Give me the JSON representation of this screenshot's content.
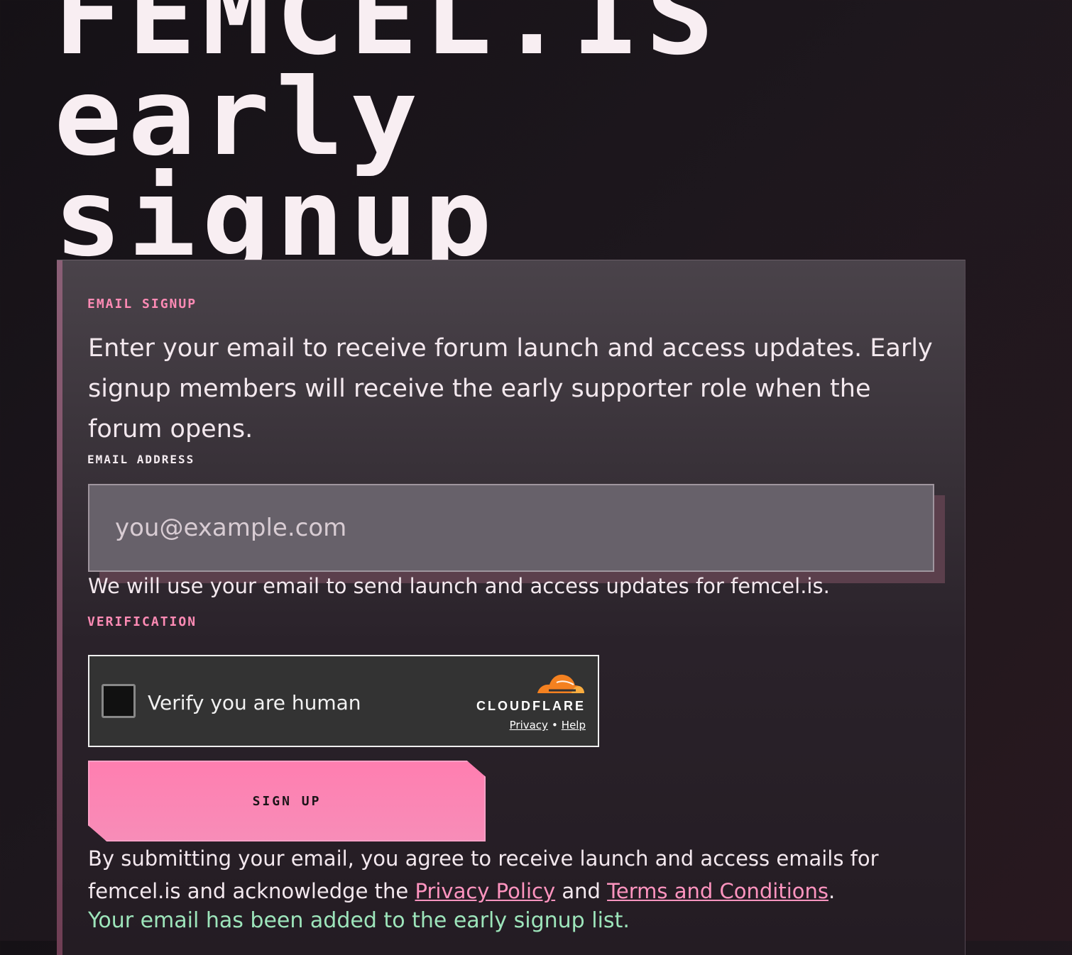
{
  "hero": {
    "line_1": "FEMCEL.IS",
    "line_2": "early",
    "line_3": "signup"
  },
  "signup": {
    "section_label": "Email signup",
    "intro": "Enter your email to receive forum launch and access updates. Early signup members will receive the early supporter role when the forum opens.",
    "email_label": "Email address",
    "email_placeholder": "you@example.com",
    "email_value": "",
    "email_help": "We will use your email to send launch and access updates for femcel.is.",
    "verification_label": "Verification",
    "submit_label": "Sign up",
    "legal_prefix": "By submitting your email, you agree to receive launch and access emails for femcel.is and acknowledge the",
    "privacy_link": "Privacy Policy",
    "and_word": "and",
    "terms_link": "Terms and Conditions",
    "legal_suffix": ".",
    "success_message": "Your email has been added to the early signup list."
  },
  "verification": {
    "checkbox_text": "Verify you are human",
    "brand": "CLOUDFLARE",
    "privacy": "Privacy",
    "separator": "•",
    "help": "Help",
    "icon": "cloudflare-cloud-icon"
  },
  "colors": {
    "accent": "#ff8bb5",
    "success": "#9de5bb",
    "cloudflare_orange": "#f48120"
  }
}
